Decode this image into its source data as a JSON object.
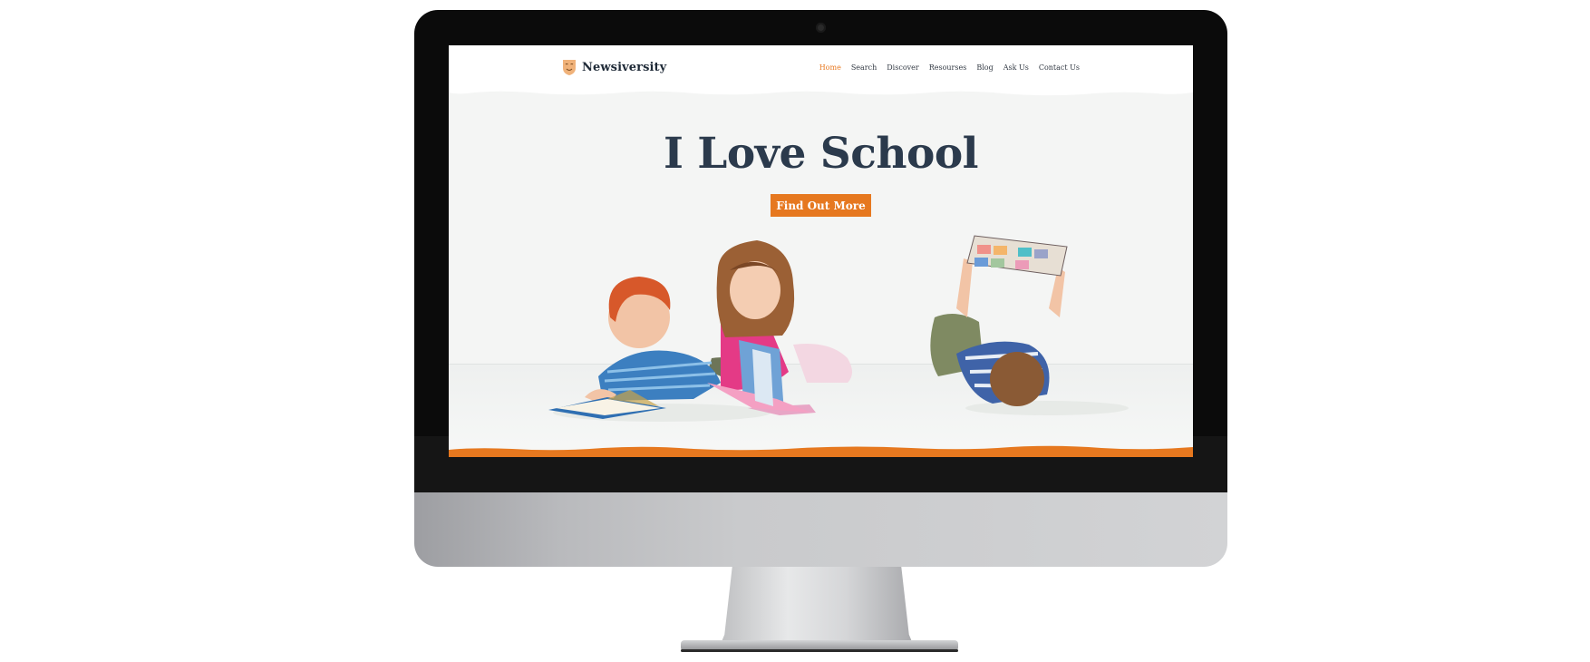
{
  "site": {
    "brand": "Newsiversity",
    "logo_icon": "shield-mask-icon",
    "accent_color": "#e6781f",
    "heading_color": "#2b3a4c"
  },
  "nav": {
    "items": [
      {
        "label": "Home",
        "active": true
      },
      {
        "label": "Search",
        "active": false
      },
      {
        "label": "Discover",
        "active": false
      },
      {
        "label": "Resourses",
        "active": false
      },
      {
        "label": "Blog",
        "active": false
      },
      {
        "label": "Ask Us",
        "active": false
      },
      {
        "label": "Contact Us",
        "active": false
      }
    ]
  },
  "hero": {
    "title": "I Love School",
    "cta_label": "Find Out More"
  },
  "device": {
    "type": "imac-mockup",
    "icon": "camera-icon"
  }
}
